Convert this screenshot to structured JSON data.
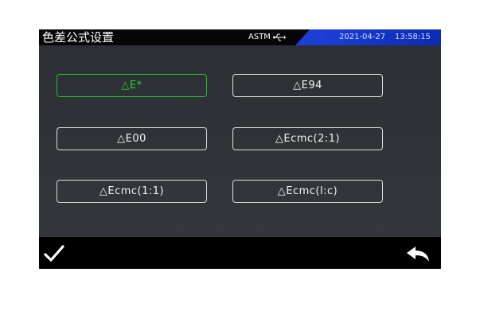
{
  "header": {
    "title": "色差公式设置",
    "standard": "ASTM",
    "usb_icon": "usb-icon",
    "date": "2021-04-27",
    "time": "13:58:15"
  },
  "formulas": [
    {
      "label": "△E*",
      "selected": true
    },
    {
      "label": "△E94",
      "selected": false
    },
    {
      "label": "△E00",
      "selected": false
    },
    {
      "label": "△Ecmc(2:1)",
      "selected": false
    },
    {
      "label": "△Ecmc(1:1)",
      "selected": false
    },
    {
      "label": "△Ecmc(l:c)",
      "selected": false
    }
  ],
  "footer": {
    "confirm_icon": "check-icon",
    "back_icon": "back-arrow-icon"
  },
  "colors": {
    "selected": "#2cd32c",
    "accent": "#1d3fd6"
  }
}
